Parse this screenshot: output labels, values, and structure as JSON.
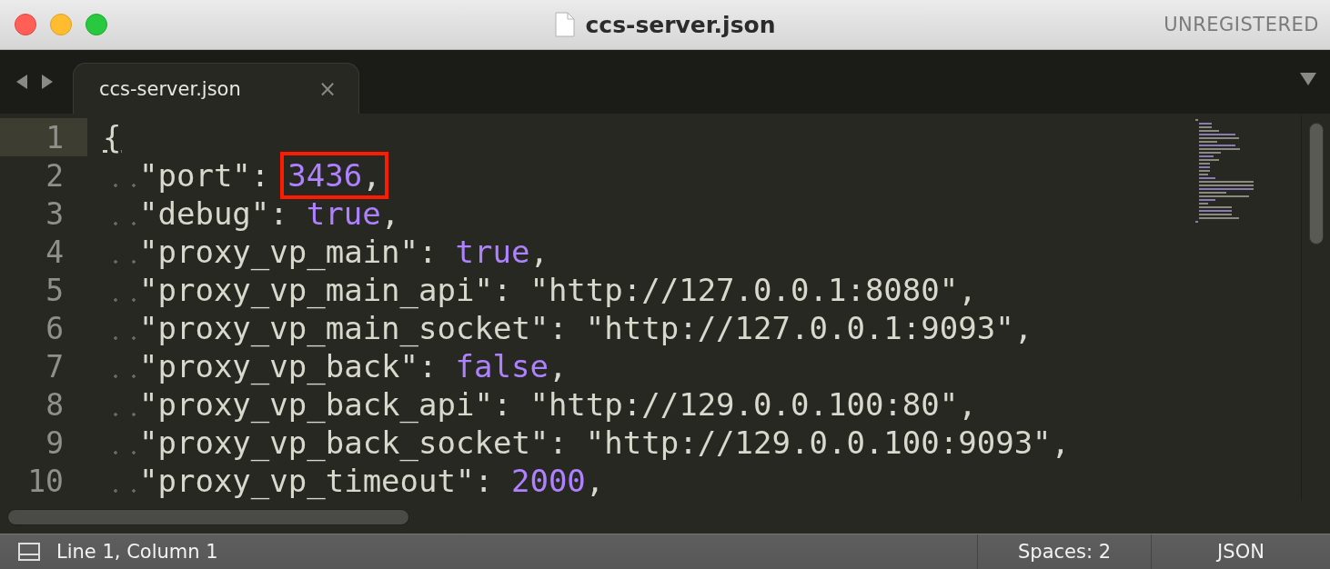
{
  "window": {
    "title": "ccs-server.json",
    "badge": "UNREGISTERED"
  },
  "tabs": [
    {
      "label": "ccs-server.json",
      "close": "×",
      "selected": true
    }
  ],
  "editor": {
    "lines": [
      {
        "number": "1",
        "current": true,
        "highlighted": false,
        "tokens": [
          {
            "kind": "brace",
            "text": "{"
          }
        ]
      },
      {
        "number": "2",
        "current": false,
        "highlighted": true,
        "tokens": [
          {
            "kind": "key",
            "text": "\"port\""
          },
          {
            "kind": "punct",
            "text": ":"
          },
          {
            "kind": "number",
            "text": "3436"
          },
          {
            "kind": "punct",
            "text": ","
          }
        ]
      },
      {
        "number": "3",
        "current": false,
        "highlighted": false,
        "tokens": [
          {
            "kind": "key",
            "text": "\"debug\""
          },
          {
            "kind": "punct",
            "text": ":"
          },
          {
            "kind": "constant",
            "text": "true"
          },
          {
            "kind": "punct",
            "text": ","
          }
        ]
      },
      {
        "number": "4",
        "current": false,
        "highlighted": false,
        "tokens": [
          {
            "kind": "key",
            "text": "\"proxy_vp_main\""
          },
          {
            "kind": "punct",
            "text": ":"
          },
          {
            "kind": "constant",
            "text": "true"
          },
          {
            "kind": "punct",
            "text": ","
          }
        ]
      },
      {
        "number": "5",
        "current": false,
        "highlighted": false,
        "tokens": [
          {
            "kind": "key",
            "text": "\"proxy_vp_main_api\""
          },
          {
            "kind": "punct",
            "text": ":"
          },
          {
            "kind": "string",
            "text": "\"http://127.0.0.1:8080\""
          },
          {
            "kind": "punct",
            "text": ","
          }
        ]
      },
      {
        "number": "6",
        "current": false,
        "highlighted": false,
        "tokens": [
          {
            "kind": "key",
            "text": "\"proxy_vp_main_socket\""
          },
          {
            "kind": "punct",
            "text": ":"
          },
          {
            "kind": "string",
            "text": "\"http://127.0.0.1:9093\""
          },
          {
            "kind": "punct",
            "text": ","
          }
        ]
      },
      {
        "number": "7",
        "current": false,
        "highlighted": false,
        "tokens": [
          {
            "kind": "key",
            "text": "\"proxy_vp_back\""
          },
          {
            "kind": "punct",
            "text": ":"
          },
          {
            "kind": "constant",
            "text": "false"
          },
          {
            "kind": "punct",
            "text": ","
          }
        ]
      },
      {
        "number": "8",
        "current": false,
        "highlighted": false,
        "tokens": [
          {
            "kind": "key",
            "text": "\"proxy_vp_back_api\""
          },
          {
            "kind": "punct",
            "text": ":"
          },
          {
            "kind": "string",
            "text": "\"http://129.0.0.100:80\""
          },
          {
            "kind": "punct",
            "text": ","
          }
        ]
      },
      {
        "number": "9",
        "current": false,
        "highlighted": false,
        "tokens": [
          {
            "kind": "key",
            "text": "\"proxy_vp_back_socket\""
          },
          {
            "kind": "punct",
            "text": ":"
          },
          {
            "kind": "string",
            "text": "\"http://129.0.0.100:9093\""
          },
          {
            "kind": "punct",
            "text": ","
          }
        ]
      },
      {
        "number": "10",
        "current": false,
        "highlighted": false,
        "tokens": [
          {
            "kind": "key",
            "text": "\"proxy_vp_timeout\""
          },
          {
            "kind": "punct",
            "text": ":"
          },
          {
            "kind": "number",
            "text": "2000"
          },
          {
            "kind": "punct",
            "text": ","
          }
        ]
      }
    ]
  },
  "status_bar": {
    "position": "Line 1, Column 1",
    "indentation": "Spaces: 2",
    "syntax": "JSON"
  }
}
